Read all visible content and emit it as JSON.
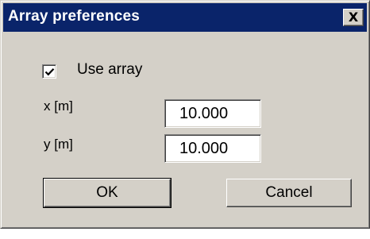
{
  "dialog": {
    "title": "Array preferences",
    "close_glyph": "X",
    "checkbox": {
      "label": "Use array",
      "checked": true,
      "icon": "checkmark-icon"
    },
    "fields": [
      {
        "label": "x [m]",
        "value": "10.000"
      },
      {
        "label": "y [m]",
        "value": "10.000"
      }
    ],
    "buttons": {
      "ok": "OK",
      "cancel": "Cancel"
    }
  },
  "colors": {
    "face": "#d4d0c8",
    "titlebar": "#0a246a",
    "title_text": "#ffffff"
  }
}
